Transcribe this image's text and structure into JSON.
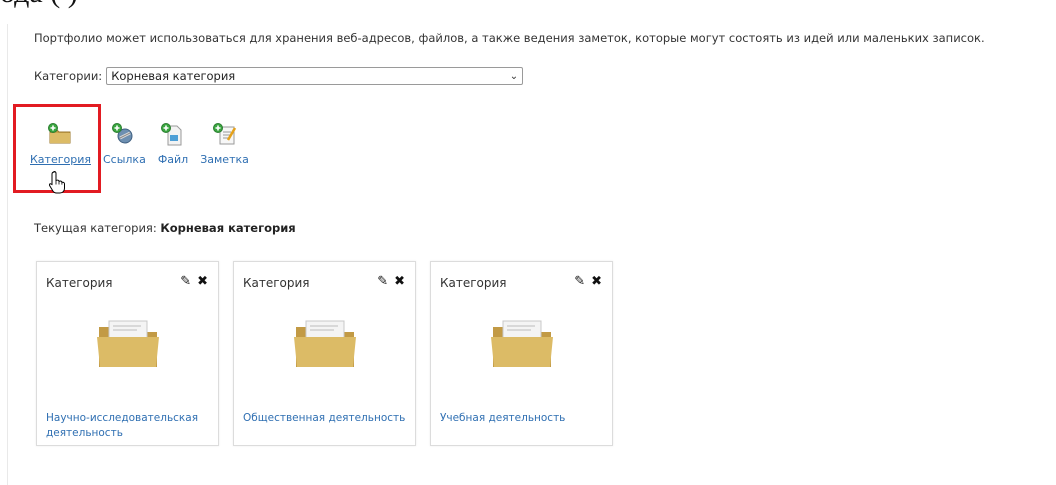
{
  "heading_fragment": "ода                                        (               )",
  "intro_text": "Портфолио может использоваться для хранения веб-адресов, файлов, а также ведения заметок, которые могут состоять из идей или маленьких записок.",
  "category_selector": {
    "label": "Категории:",
    "selected": "Корневая категория"
  },
  "actions": [
    {
      "label": "Категория",
      "icon": "add-folder-icon"
    },
    {
      "label": "Ссылка",
      "icon": "add-link-icon"
    },
    {
      "label": "Файл",
      "icon": "add-file-icon"
    },
    {
      "label": "Заметка",
      "icon": "add-note-icon"
    }
  ],
  "current_category": {
    "label": "Текущая категория:",
    "value": "Корневая категория"
  },
  "cards": [
    {
      "type": "Категория",
      "name": "Научно-исследовательская деятельность"
    },
    {
      "type": "Категория",
      "name": "Общественная деятельность"
    },
    {
      "type": "Категория",
      "name": "Учебная деятельность"
    }
  ],
  "colors": {
    "link": "#2f6fb2",
    "highlight": "#e21b22",
    "folder": "#d8b25c"
  }
}
